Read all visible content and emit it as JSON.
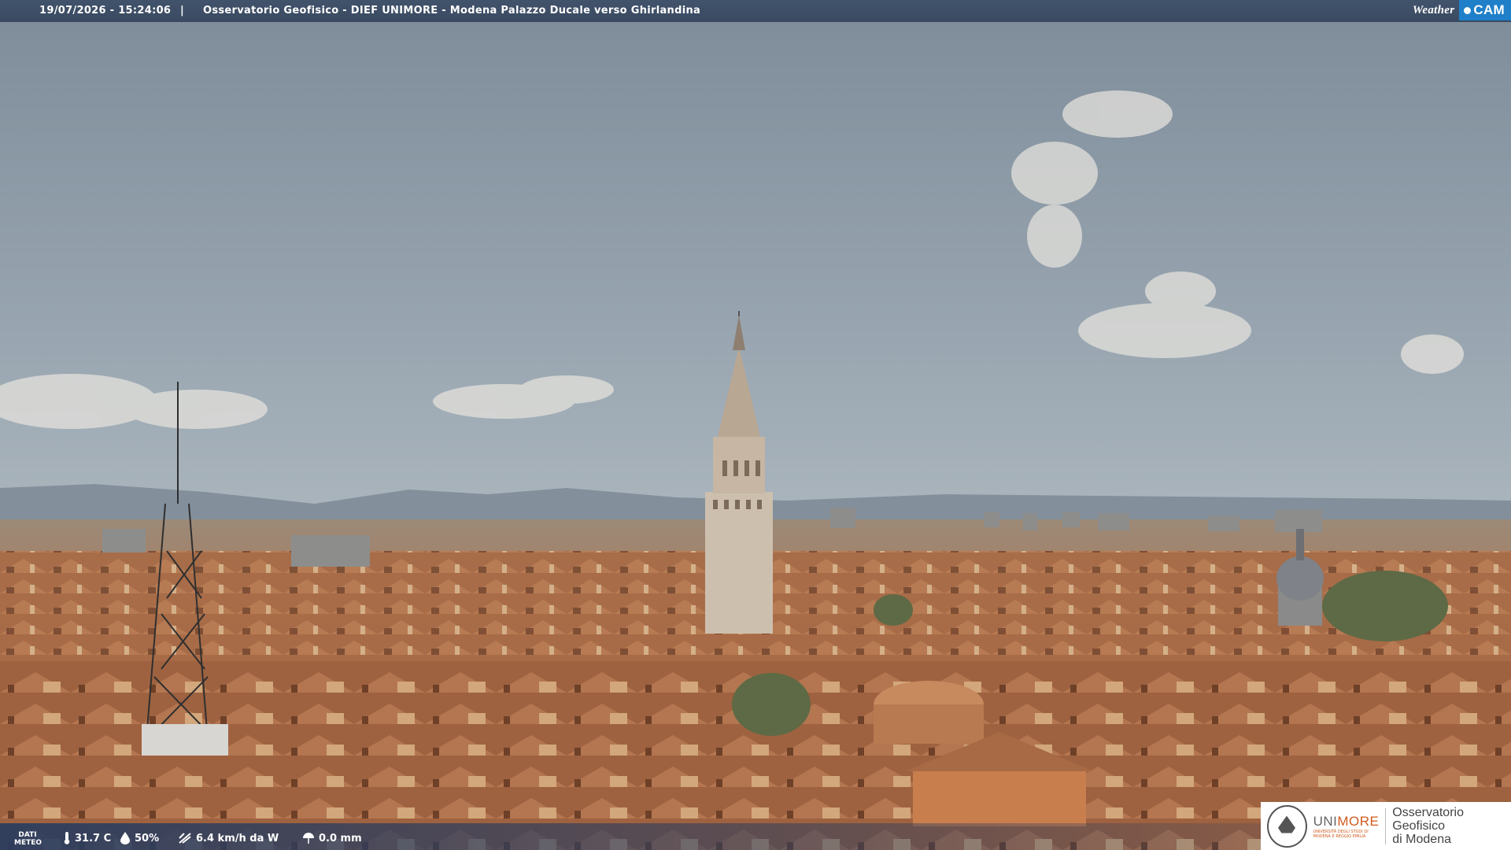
{
  "header": {
    "timestamp": "19/07/2026 - 15:24:06",
    "separator": "|",
    "title": "Osservatorio Geofisico - DIEF UNIMORE - Modena Palazzo Ducale verso Ghirlandina"
  },
  "brand": {
    "weather": "Weather",
    "cam": "CAM"
  },
  "meteo": {
    "label_line1": "DATI",
    "label_line2": "METEO",
    "temperature": "31.7 C",
    "humidity": "50%",
    "wind": "6.4 km/h da W",
    "rain": "0.0 mm"
  },
  "logo": {
    "uni_a": "UNI",
    "uni_b": "MORE",
    "uni_sub_1": "UNIVERSITÀ DEGLI STUDI DI",
    "uni_sub_2": "MODENA E REGGIO EMILIA",
    "obs_line1": "Osservatorio Geofisico",
    "obs_line2": "di Modena"
  },
  "colors": {
    "accent": "#1f7fc9",
    "unimore": "#d15b1e"
  }
}
